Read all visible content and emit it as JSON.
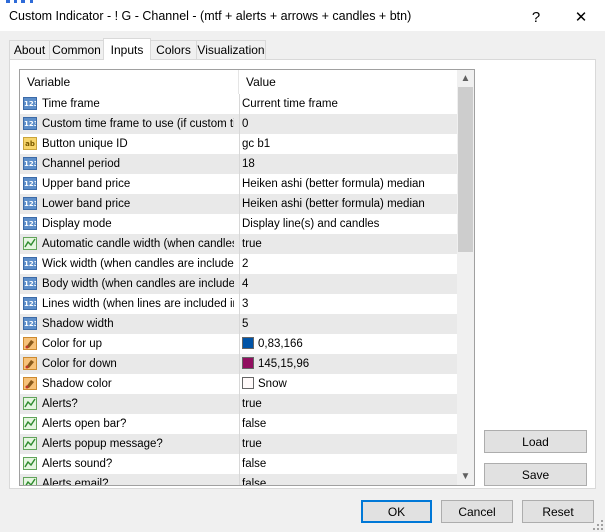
{
  "window": {
    "title": "Custom Indicator - ! G - Channel - (mtf + alerts + arrows + candles + btn)",
    "help_glyph": "?",
    "close_glyph": "✕"
  },
  "tabs": [
    {
      "label": "About"
    },
    {
      "label": "Common"
    },
    {
      "label": "Inputs"
    },
    {
      "label": "Colors"
    },
    {
      "label": "Visualization"
    }
  ],
  "grid": {
    "header": {
      "variable": "Variable",
      "value": "Value"
    },
    "rows": [
      {
        "icon": "num",
        "icon_text": "123",
        "name": "Time frame",
        "value": "Current time frame"
      },
      {
        "icon": "num",
        "icon_text": "123",
        "name": "Custom time frame to use (if custom tim...",
        "value": "0"
      },
      {
        "icon": "str",
        "icon_text": "ab",
        "name": "Button unique ID",
        "value": "gc b1"
      },
      {
        "icon": "num",
        "icon_text": "123",
        "name": "Channel period",
        "value": "18"
      },
      {
        "icon": "num",
        "icon_text": "123",
        "name": "Upper band price",
        "value": "Heiken ashi (better formula) median"
      },
      {
        "icon": "num",
        "icon_text": "123",
        "name": "Lower band price",
        "value": "Heiken ashi (better formula) median"
      },
      {
        "icon": "num",
        "icon_text": "123",
        "name": "Display mode",
        "value": "Display line(s) and candles"
      },
      {
        "icon": "bool",
        "icon_text": "",
        "name": "Automatic candle width (when candles...",
        "value": "true"
      },
      {
        "icon": "num",
        "icon_text": "123",
        "name": "Wick width (when candles are include...",
        "value": "2"
      },
      {
        "icon": "num",
        "icon_text": "123",
        "name": "Body width (when candles are include...",
        "value": "4"
      },
      {
        "icon": "num",
        "icon_text": "123",
        "name": "Lines width (when lines are included in ...",
        "value": "3"
      },
      {
        "icon": "num",
        "icon_text": "123",
        "name": "Shadow width",
        "value": "5"
      },
      {
        "icon": "col",
        "icon_text": "",
        "name": "Color for up",
        "value": "0,83,166",
        "swatch": "#0053a6"
      },
      {
        "icon": "col",
        "icon_text": "",
        "name": "Color for down",
        "value": "145,15,96",
        "swatch": "#910f60"
      },
      {
        "icon": "col",
        "icon_text": "",
        "name": "Shadow color",
        "value": "Snow",
        "swatch": "#fffafa"
      },
      {
        "icon": "bool",
        "icon_text": "",
        "name": "Alerts?",
        "value": "true"
      },
      {
        "icon": "bool",
        "icon_text": "",
        "name": "Alerts open bar?",
        "value": "false"
      },
      {
        "icon": "bool",
        "icon_text": "",
        "name": "Alerts popup message?",
        "value": "true"
      },
      {
        "icon": "bool",
        "icon_text": "",
        "name": "Alerts sound?",
        "value": "false"
      },
      {
        "icon": "bool",
        "icon_text": "",
        "name": "Alerts email?",
        "value": "false"
      }
    ]
  },
  "side_buttons": {
    "load": "Load",
    "save": "Save"
  },
  "footer_buttons": {
    "ok": "OK",
    "cancel": "Cancel",
    "reset": "Reset"
  },
  "colors": {
    "accent": "#0078d7",
    "title_strip": "#2e6bd8"
  }
}
